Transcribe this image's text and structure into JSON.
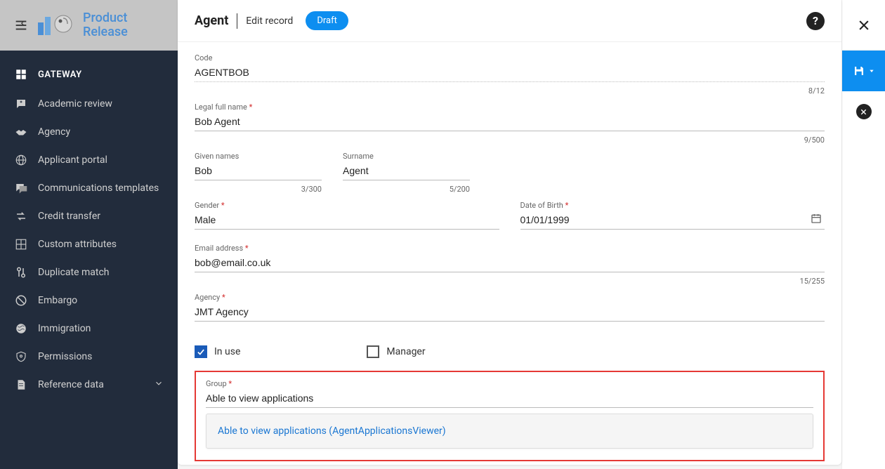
{
  "brand": {
    "line1": "Product",
    "line2": "Release"
  },
  "sidebar": {
    "section": "GATEWAY",
    "items": [
      {
        "label": "Academic review"
      },
      {
        "label": "Agency"
      },
      {
        "label": "Applicant portal"
      },
      {
        "label": "Communications templates"
      },
      {
        "label": "Credit transfer"
      },
      {
        "label": "Custom attributes"
      },
      {
        "label": "Duplicate match"
      },
      {
        "label": "Embargo"
      },
      {
        "label": "Immigration"
      },
      {
        "label": "Permissions"
      },
      {
        "label": "Reference data",
        "has_chevron": true
      }
    ]
  },
  "header": {
    "entity": "Agent",
    "mode": "Edit record",
    "badge": "Draft"
  },
  "form": {
    "code_label": "Code",
    "code_value": "AGENTBOB",
    "code_counter": "8/12",
    "legal_name_label": "Legal full name",
    "legal_name_value": "Bob Agent",
    "legal_name_counter": "9/500",
    "given_names_label": "Given names",
    "given_names_value": "Bob",
    "given_names_counter": "3/300",
    "surname_label": "Surname",
    "surname_value": "Agent",
    "surname_counter": "5/200",
    "gender_label": "Gender",
    "gender_value": "Male",
    "dob_label": "Date of Birth",
    "dob_value": "01/01/1999",
    "email_label": "Email address",
    "email_value": "bob@email.co.uk",
    "email_counter": "15/255",
    "agency_label": "Agency",
    "agency_value": "JMT Agency",
    "in_use_label": "In use",
    "manager_label": "Manager",
    "group_label": "Group",
    "group_value": "Able to view applications",
    "group_option": "Able to view applications (AgentApplicationsViewer)"
  }
}
